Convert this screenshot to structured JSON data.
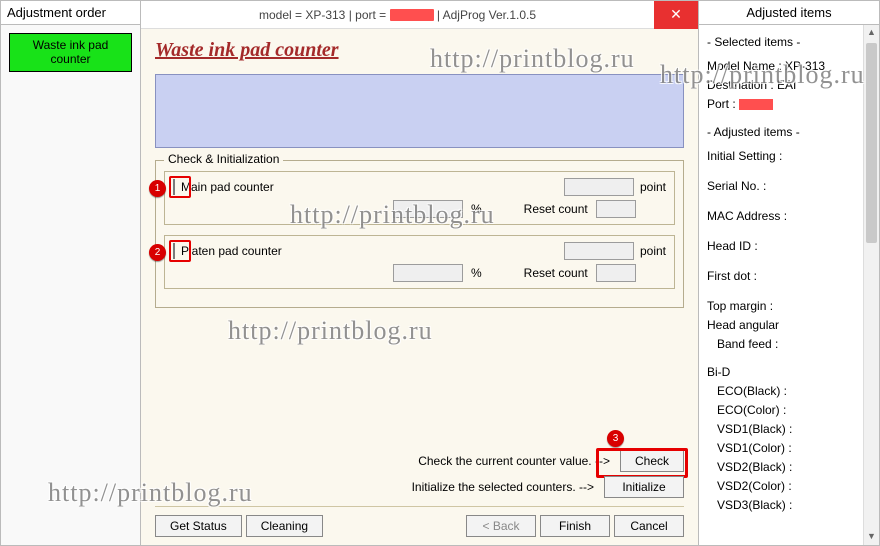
{
  "left": {
    "header": "Adjustment order",
    "waste_btn": "Waste ink pad counter"
  },
  "window": {
    "title_prefix": "model = XP-313 | port = ",
    "title_suffix": " | AdjProg Ver.1.0.5",
    "close": "✕"
  },
  "main": {
    "title": "Waste ink pad counter",
    "group_legend": "Check & Initialization",
    "pads": [
      {
        "badge": "1",
        "name": "Main pad counter",
        "unit1": "point",
        "unit2": "%",
        "reset_label": "Reset count"
      },
      {
        "badge": "2",
        "name": "Platen pad counter",
        "unit1": "point",
        "unit2": "%",
        "reset_label": "Reset count"
      }
    ],
    "check_hint": "Check the current counter value.  -->",
    "init_hint": "Initialize the selected counters.  -->",
    "check_btn": "Check",
    "init_btn": "Initialize",
    "badge3": "3"
  },
  "bottom": {
    "get_status": "Get Status",
    "cleaning": "Cleaning",
    "back": "< Back",
    "finish": "Finish",
    "cancel": "Cancel"
  },
  "right": {
    "header": "Adjusted items",
    "selected_header": "- Selected items -",
    "model_name": "Model Name : XP-313",
    "destination": "Destination : EAI",
    "port_label": "Port : ",
    "adjusted_header": "- Adjusted items -",
    "rows": [
      "Initial Setting :",
      "Serial No. :",
      "MAC Address :",
      "Head ID :",
      "First dot :",
      "Top margin :",
      "Head angular",
      " Band feed :",
      "Bi-D",
      "  ECO(Black)  :",
      "  ECO(Color)  :",
      "  VSD1(Black) :",
      "  VSD1(Color) :",
      "  VSD2(Black) :",
      "  VSD2(Color) :",
      "  VSD3(Black) :"
    ]
  },
  "watermark": "http://printblog.ru"
}
